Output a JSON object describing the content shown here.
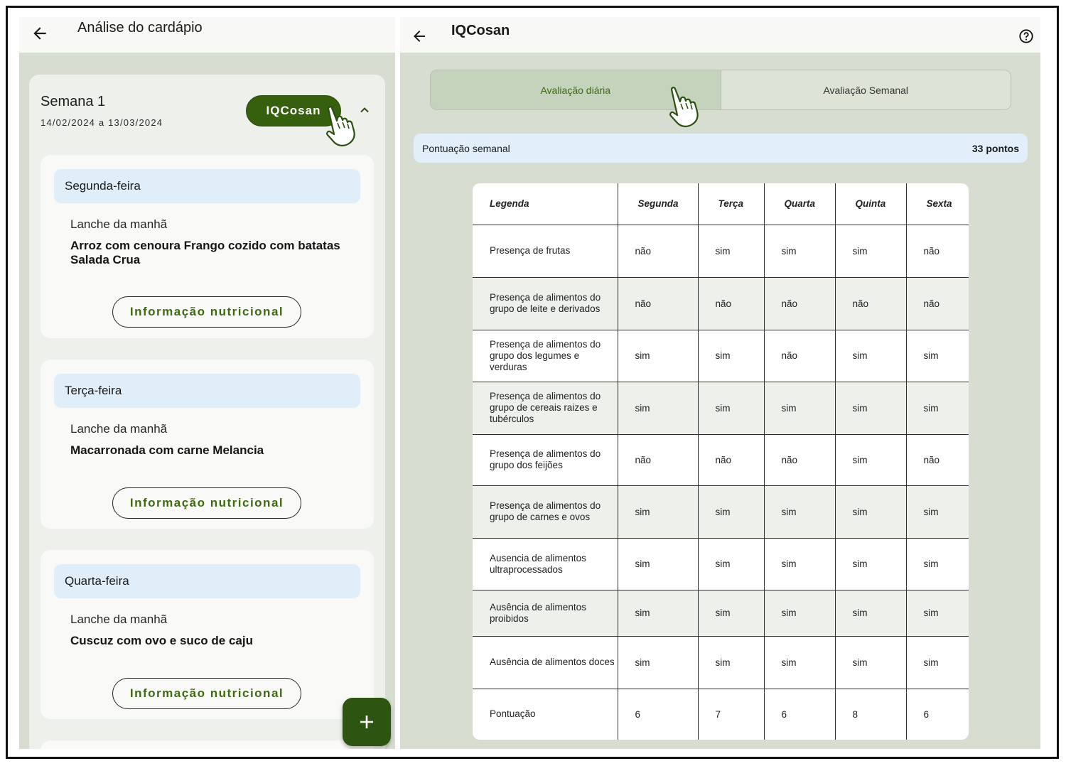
{
  "left": {
    "title": "Análise do cardápio",
    "week": {
      "title": "Semana 1",
      "dates": "14/02/2024 a 13/03/2024",
      "iq_button": "IQCosan"
    },
    "days": [
      {
        "name": "Segunda-feira",
        "meal": "Lanche da manhã",
        "desc": "Arroz com cenoura Frango cozido com batatas Salada Crua",
        "button": "Informação nutricional"
      },
      {
        "name": "Terça-feira",
        "meal": "Lanche da manhã",
        "desc": "Macarronada com carne Melancia",
        "button": "Informação nutricional"
      },
      {
        "name": "Quarta-feira",
        "meal": "Lanche da manhã",
        "desc": "Cuscuz com ovo e suco de caju",
        "button": "Informação nutricional"
      }
    ],
    "fab_label": "+"
  },
  "right": {
    "title": "IQCosan",
    "tabs": [
      "Avaliação diária",
      "Avaliação Semanal"
    ],
    "active_tab": 0,
    "score": {
      "label": "Pontuação semanal",
      "value": "33 pontos"
    },
    "table": {
      "headers": [
        "Legenda",
        "Segunda",
        "Terça",
        "Quarta",
        "Quinta",
        "Sexta"
      ],
      "rows": [
        {
          "legend": "Presença de frutas",
          "values": [
            "não",
            "sim",
            "sim",
            "sim",
            "não"
          ]
        },
        {
          "legend": "Presença de alimentos do grupo de leite e derivados",
          "values": [
            "não",
            "não",
            "não",
            "não",
            "não"
          ]
        },
        {
          "legend": "Presença de alimentos do grupo dos legumes e verduras",
          "values": [
            "sim",
            "sim",
            "não",
            "sim",
            "sim"
          ]
        },
        {
          "legend": "Presença de alimentos do grupo de cereais raizes e tubérculos",
          "values": [
            "sim",
            "sim",
            "sim",
            "sim",
            "sim"
          ]
        },
        {
          "legend": "Presença de alimentos do grupo dos feijões",
          "values": [
            "não",
            "não",
            "não",
            "sim",
            "não"
          ]
        },
        {
          "legend": "Presença de alimentos do grupo de carnes e ovos",
          "values": [
            "sim",
            "sim",
            "sim",
            "sim",
            "sim"
          ]
        },
        {
          "legend": "Ausencia de alimentos ultraprocessados",
          "values": [
            "sim",
            "sim",
            "sim",
            "sim",
            "sim"
          ]
        },
        {
          "legend": "Ausência de alimentos proibidos",
          "values": [
            "sim",
            "sim",
            "sim",
            "sim",
            "sim"
          ]
        },
        {
          "legend": "Ausência de alimentos doces",
          "values": [
            "sim",
            "sim",
            "sim",
            "sim",
            "sim"
          ]
        },
        {
          "legend": "Pontuação",
          "values": [
            "6",
            "7",
            "6",
            "8",
            "6"
          ]
        }
      ]
    }
  },
  "colors": {
    "primary_green": "#36600e",
    "green_text": "#3f6a13",
    "bg_sage": "#d7ddd1",
    "light_blue": "#e0eefa"
  },
  "icons": [
    "back-arrow-icon",
    "chevron-up-icon",
    "pointer-hand-icon",
    "plus-icon",
    "help-circle-icon"
  ]
}
